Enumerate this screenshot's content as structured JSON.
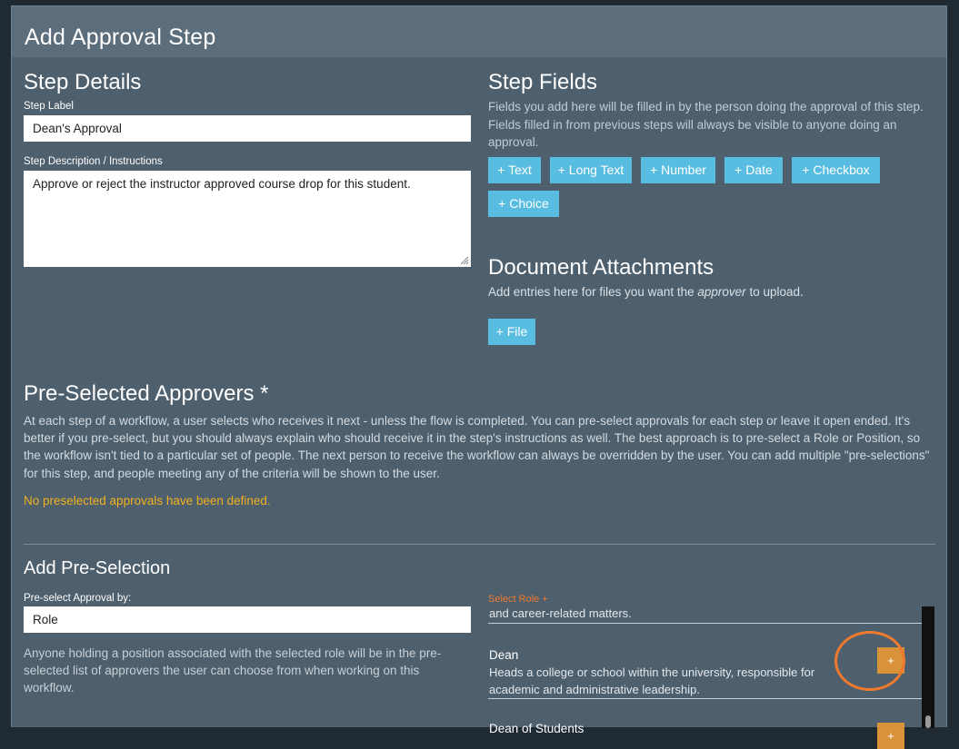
{
  "modal": {
    "title": "Add Approval Step"
  },
  "step_details": {
    "heading": "Step Details",
    "label_field": {
      "label": "Step Label",
      "value": "Dean's Approval"
    },
    "description_field": {
      "label": "Step Description / Instructions",
      "value": "Approve or reject the instructor approved course drop for this student."
    }
  },
  "step_fields": {
    "heading": "Step Fields",
    "description": "Fields you add here will be filled in by the person doing the approval of this step. Fields filled in from previous steps will always be visible to anyone doing an approval.",
    "buttons": [
      "+ Text",
      "+ Long Text",
      "+ Number",
      "+ Date",
      "+ Checkbox",
      "+ Choice"
    ]
  },
  "attachments": {
    "heading": "Document Attachments",
    "desc_before": "Add entries here for files you want the ",
    "desc_em": "approver",
    "desc_after": " to upload.",
    "file_button": "+ File"
  },
  "preselected": {
    "heading": "Pre-Selected Approvers *",
    "description": "At each step of a workflow, a user selects who receives it next - unless the flow is completed. You can pre-select approvals for each step or leave it open ended. It's better if you pre-select, but you should always explain who should receive it in the step's instructions as well. The best approach is to pre-select a Role or Position, so the workflow isn't tied to a particular set of people. The next person to receive the workflow can always be overridden by the user. You can add multiple \"pre-selections\" for this step, and people meeting any of the criteria will be shown to the user.",
    "empty_notice": "No preselected approvals have been defined."
  },
  "add_preselection": {
    "heading": "Add Pre-Selection",
    "by_label": "Pre-select Approval by:",
    "by_value": "Role",
    "help": "Anyone holding a position associated with the selected role will be in the pre-selected list of approvers the user can choose from when working on this workflow.",
    "select_role_label": "Select Role +",
    "roles": [
      {
        "partial_desc": "and career-related matters."
      },
      {
        "name": "Dean",
        "desc": "Heads a college or school within the university, responsible for academic and administrative leadership.",
        "add": "+"
      },
      {
        "name": "Dean of Students",
        "add": "+"
      }
    ]
  },
  "colors": {
    "accent_button": "#58bde0",
    "add_button": "#d9913a",
    "warning": "#f2b01e",
    "highlight": "#ef7a2d"
  }
}
